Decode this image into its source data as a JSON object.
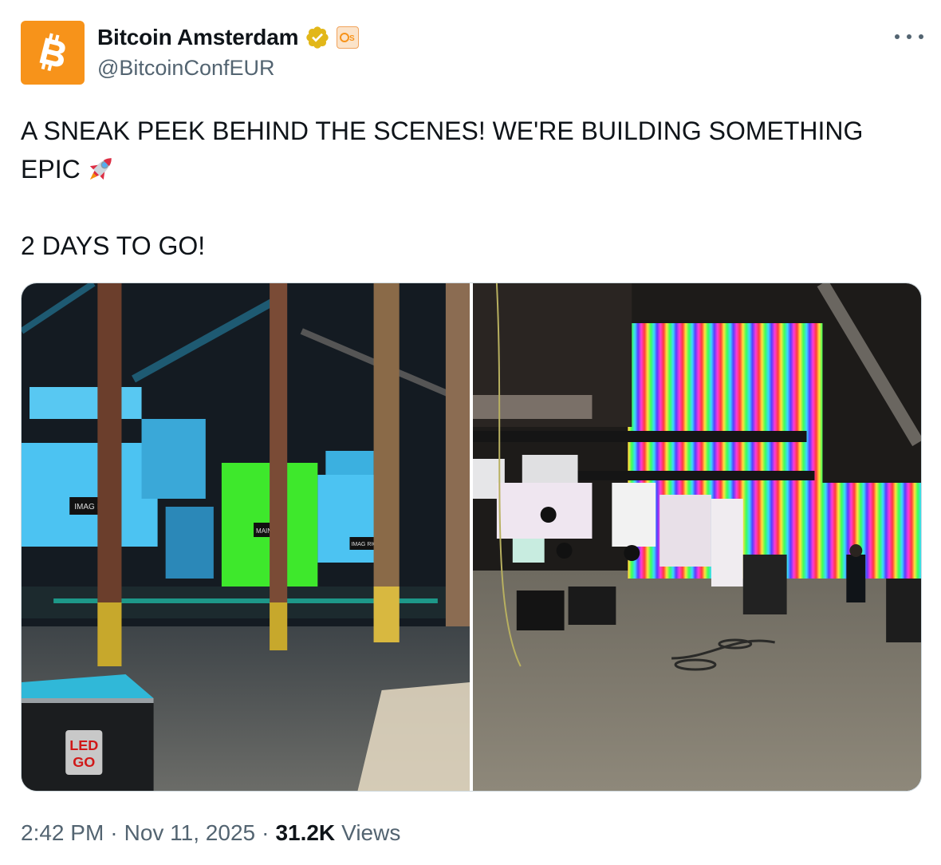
{
  "author": {
    "display_name": "Bitcoin Amsterdam",
    "handle": "@BitcoinConfEUR",
    "avatar_icon": "bitcoin-logo",
    "avatar_color": "#f7931a",
    "verified_icon": "verified-gold-badge",
    "affiliate_icon": "affiliate-badge"
  },
  "tweet": {
    "line1": "A SNEAK PEEK BEHIND THE SCENES! WE'RE BUILDING SOMETHING",
    "line2": "EPIC",
    "emoji_icon": "rocket-emoji",
    "line3": "2 DAYS TO GO!"
  },
  "media": [
    {
      "icon": "photo-stage-led-screens-blue-green",
      "labels": [
        "LED",
        "GO",
        "IMAG L",
        "MAIN",
        "IMAG RIGHT"
      ]
    },
    {
      "icon": "photo-stage-led-wall-rainbow"
    }
  ],
  "meta": {
    "time": "2:42 PM",
    "separator": "·",
    "date": "Nov 11, 2025",
    "views_count": "31.2K",
    "views_label": "Views"
  }
}
